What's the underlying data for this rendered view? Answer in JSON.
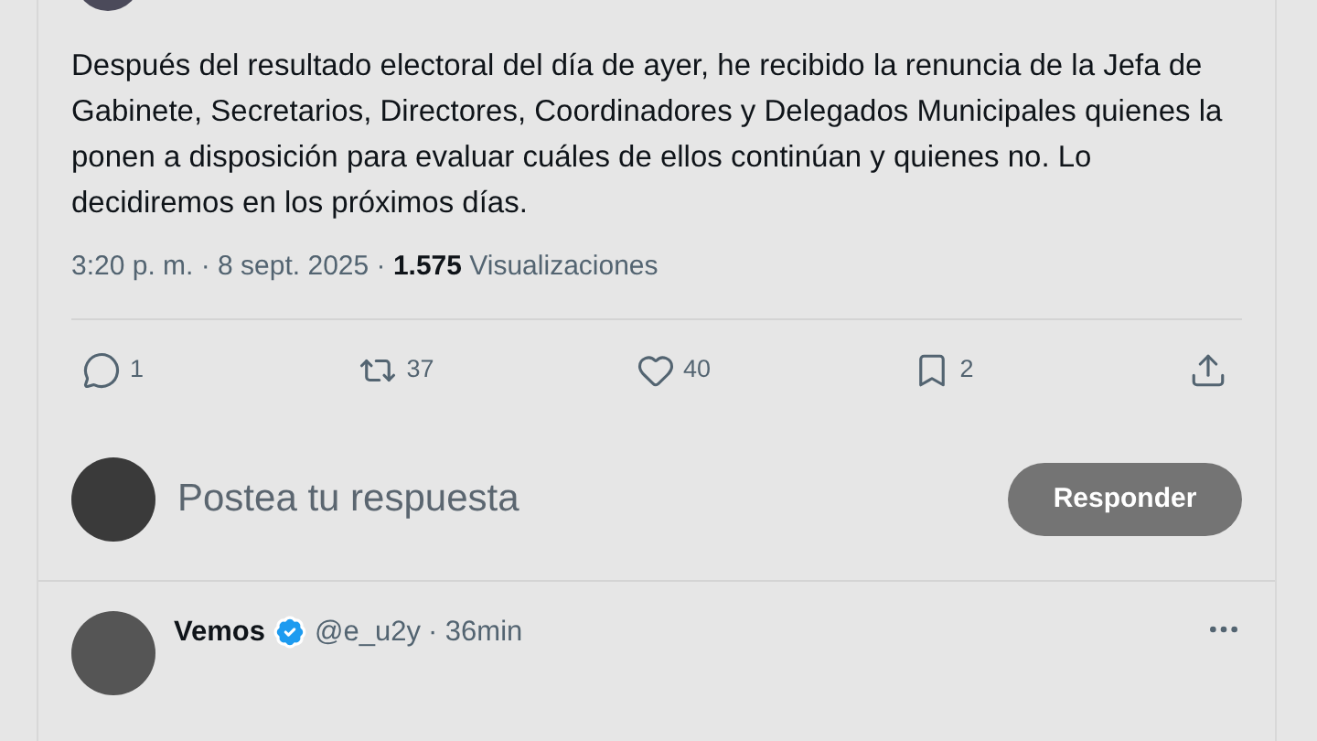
{
  "tweet": {
    "text": "Después del resultado electoral del día de ayer, he recibido la renuncia de la Jefa de Gabinete, Secretarios, Directores, Coordinadores y Delegados Municipales quienes la ponen a disposición para evaluar cuáles de ellos continúan y quienes no. Lo decidiremos en los próximos días.",
    "meta": "3:20 p. m. · 8 sept. 2025 · **1.575** Visualizaciones"
  },
  "actions": [
    {
      "kind": "reply",
      "count": "1"
    },
    {
      "kind": "repost",
      "count": "37"
    },
    {
      "kind": "like",
      "count": "40"
    },
    {
      "kind": "bookmark",
      "count": "2"
    },
    {
      "kind": "share"
    }
  ],
  "composer": {
    "placeholder": "Postea tu respuesta",
    "button": "Responder"
  },
  "replies": [
    {
      "name": "Vemos",
      "verified": true,
      "handle": "@e_u2y",
      "time": "· 36min"
    }
  ]
}
